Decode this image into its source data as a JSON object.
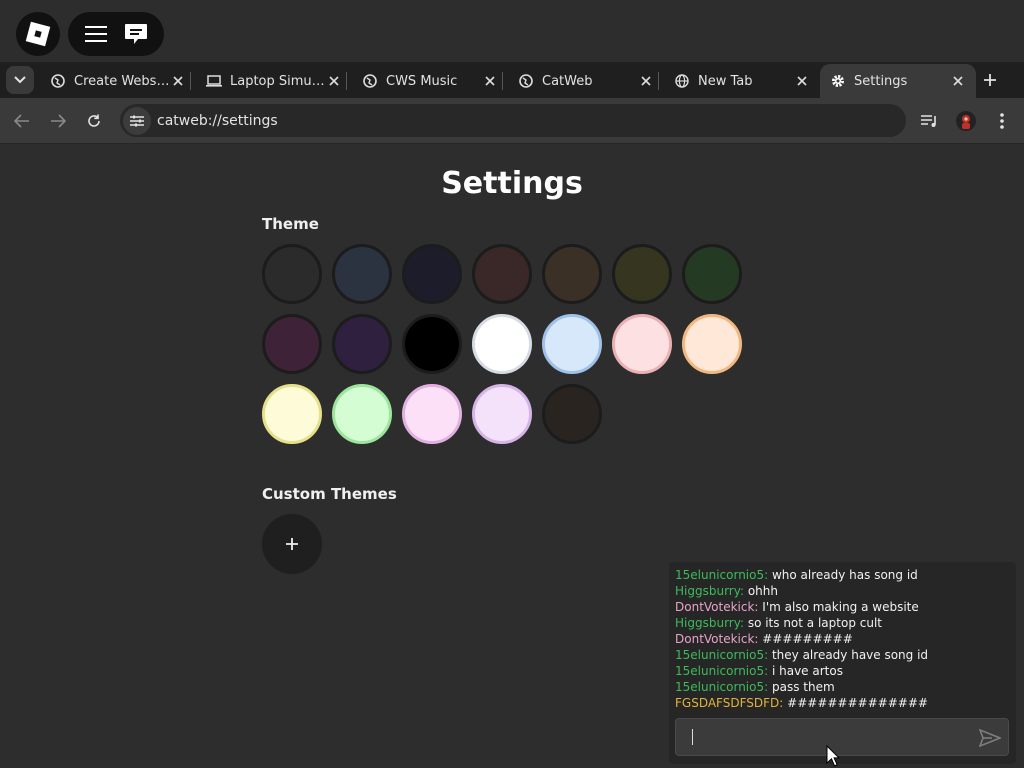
{
  "tabs": [
    {
      "label": "Create Website",
      "icon": "globe-icon",
      "active": false
    },
    {
      "label": "Laptop Simulator",
      "icon": "laptop-icon",
      "active": false
    },
    {
      "label": "CWS Music",
      "icon": "globe-icon",
      "active": false
    },
    {
      "label": "CatWeb",
      "icon": "globe-icon",
      "active": false
    },
    {
      "label": "New Tab",
      "icon": "world-icon",
      "active": false
    },
    {
      "label": "Settings",
      "icon": "gear-icon",
      "active": true
    }
  ],
  "toolbar": {
    "url": "catweb://settings"
  },
  "page": {
    "title": "Settings",
    "theme_label": "Theme",
    "custom_themes_label": "Custom Themes",
    "add_symbol": "+"
  },
  "themes": [
    {
      "color": "#2b2b2b",
      "border": "#1c1c1c"
    },
    {
      "color": "#2b3240",
      "border": "#1c1c1c"
    },
    {
      "color": "#1c1c2a",
      "border": "#1c1c1c"
    },
    {
      "color": "#3a2828",
      "border": "#1c1c1c"
    },
    {
      "color": "#3a3026",
      "border": "#1c1c1c"
    },
    {
      "color": "#363520",
      "border": "#1c1c1c"
    },
    {
      "color": "#253a22",
      "border": "#1c1c1c"
    },
    {
      "color": "#3d2238",
      "border": "#1c1c1c"
    },
    {
      "color": "#302040",
      "border": "#1c1c1c"
    },
    {
      "color": "#000000",
      "border": "#1c1c1c"
    },
    {
      "color": "#ffffff",
      "border": "#d6dbe4"
    },
    {
      "color": "#d8e8fb",
      "border": "#9fc0e8"
    },
    {
      "color": "#fde0e2",
      "border": "#eab0b4"
    },
    {
      "color": "#ffe8d8",
      "border": "#f2b880"
    },
    {
      "color": "#fdfbd8",
      "border": "#e6e08a"
    },
    {
      "color": "#d4fdd4",
      "border": "#9be69b"
    },
    {
      "color": "#fbe0f8",
      "border": "#e2b0e0"
    },
    {
      "color": "#f4e2fb",
      "border": "#d6b4e8"
    },
    {
      "color": "#2a2420",
      "border": "#1c1c1c"
    }
  ],
  "chat": {
    "messages": [
      {
        "user": "15elunicornio5:",
        "text": " who already has song id",
        "color": "#3dbb5a"
      },
      {
        "user": "Higgsburry:",
        "text": " ohhh",
        "color": "#3dbb5a"
      },
      {
        "user": "DontVotekick:",
        "text": " I'm also making a website",
        "color": "#e8a3c8"
      },
      {
        "user": "Higgsburry:",
        "text": " so its not a laptop cult",
        "color": "#3dbb5a"
      },
      {
        "user": "DontVotekick:",
        "text": " #########",
        "color": "#e8a3c8"
      },
      {
        "user": "15elunicornio5:",
        "text": " they already have song id",
        "color": "#3dbb5a"
      },
      {
        "user": "15elunicornio5:",
        "text": " i have artos",
        "color": "#3dbb5a"
      },
      {
        "user": "15elunicornio5:",
        "text": " pass them",
        "color": "#3dbb5a"
      },
      {
        "user": "FGSDAFSDFSDFD:",
        "text": " ##############",
        "color": "#e0b53a"
      }
    ],
    "input_value": ""
  }
}
